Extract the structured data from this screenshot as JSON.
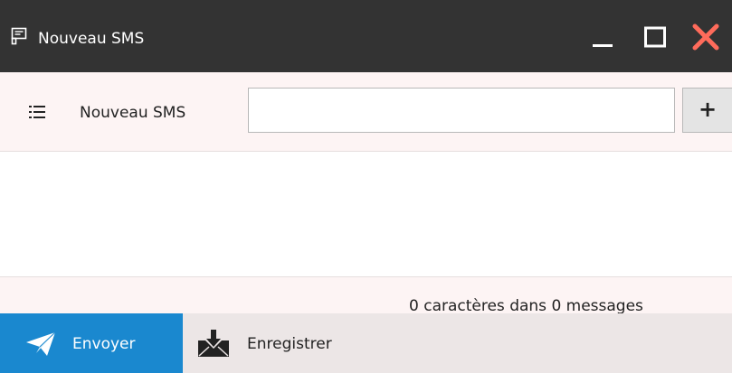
{
  "window": {
    "title": "Nouveau SMS",
    "app_icon": "sms-window-icon",
    "minimize_icon": "minimize-icon",
    "maximize_icon": "maximize-icon",
    "close_icon": "close-icon",
    "close_color": "#ff6b5b"
  },
  "recipient_bar": {
    "menu_icon": "list-icon",
    "label": "Nouveau SMS",
    "input_value": "",
    "add_label": "+"
  },
  "message": {
    "value": ""
  },
  "counter": {
    "text": "0 caractères dans 0 messages"
  },
  "toolbar": {
    "send_label": "Envoyer",
    "send_icon": "paper-plane-icon",
    "send_color": "#1a88cf",
    "save_label": "Enregistrer",
    "save_icon": "save-envelope-icon"
  }
}
